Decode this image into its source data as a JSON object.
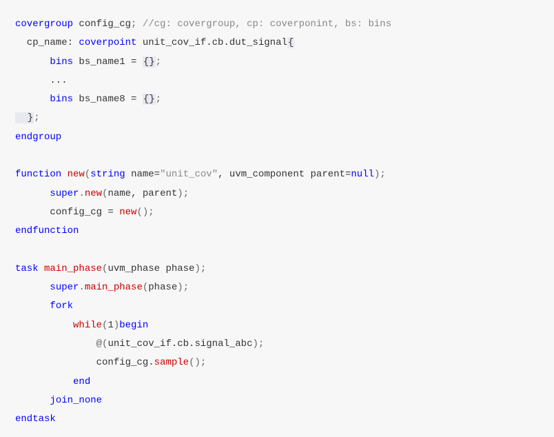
{
  "code": {
    "l1_kw1": "covergroup",
    "l1_id1": " config_cg",
    "l1_semi": ";",
    "l1_comment": " //cg: covergroup, cp: coverponint, bs: bins",
    "l2_id1": "  cp_name: ",
    "l2_kw1": "coverpoint",
    "l2_id2": " unit_cov_if.cb.dut_signal",
    "l2_brace": "{",
    "l3_indent": "      ",
    "l3_kw": "bins",
    "l3_id": " bs_name1 = ",
    "l3_braces": "{}",
    "l3_semi": ";",
    "l4": "      ...",
    "l5_indent": "      ",
    "l5_kw": "bins",
    "l5_id": " bs_name8 = ",
    "l5_braces": "{}",
    "l5_semi": ";",
    "l6_brace": "  }",
    "l6_semi": ";",
    "l7": "endgroup",
    "l8": "",
    "l9_kw1": "function",
    "l9_sp1": " ",
    "l9_kw2": "new",
    "l9_paren1": "(",
    "l9_kw3": "string",
    "l9_id1": " name=",
    "l9_str": "\"unit_cov\"",
    "l9_id2": ", uvm_component parent=",
    "l9_kw4": "null",
    "l9_paren2": ")",
    "l9_semi": ";",
    "l10_indent": "      ",
    "l10_kw1": "super",
    "l10_dot": ".",
    "l10_kw2": "new",
    "l10_paren1": "(",
    "l10_id": "name, parent",
    "l10_paren2": ")",
    "l10_semi": ";",
    "l11_indent": "      ",
    "l11_id": "config_cg = ",
    "l11_kw": "new",
    "l11_parens": "()",
    "l11_semi": ";",
    "l12": "endfunction",
    "l13": "",
    "l14_kw1": "task",
    "l14_sp": " ",
    "l14_kw2": "main_phase",
    "l14_paren1": "(",
    "l14_id": "uvm_phase phase",
    "l14_paren2": ")",
    "l14_semi": ";",
    "l15_indent": "      ",
    "l15_kw1": "super",
    "l15_dot": ".",
    "l15_kw2": "main_phase",
    "l15_paren1": "(",
    "l15_id": "phase",
    "l15_paren2": ")",
    "l15_semi": ";",
    "l16_indent": "      ",
    "l16_kw": "fork",
    "l17_indent": "          ",
    "l17_kw1": "while",
    "l17_paren1": "(",
    "l17_num": "1",
    "l17_paren2": ")",
    "l17_kw2": "begin",
    "l18_indent": "              ",
    "l18_at": "@",
    "l18_paren1": "(",
    "l18_id": "unit_cov_if.cb.signal_abc",
    "l18_paren2": ")",
    "l18_semi": ";",
    "l19_indent": "              ",
    "l19_id": "config_cg.",
    "l19_kw": "sample",
    "l19_parens": "()",
    "l19_semi": ";",
    "l20_indent": "          ",
    "l20_kw": "end",
    "l21_indent": "      ",
    "l21_kw": "join_none",
    "l22": "endtask"
  }
}
